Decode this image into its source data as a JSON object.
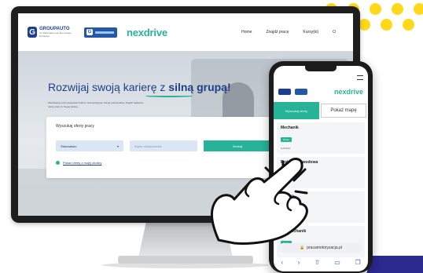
{
  "website": {
    "logo_groupauto": {
      "name": "GROUPAUTO",
      "sub": "Un Partenaire Lieu Du Groupe Européen"
    },
    "logo_box_initial": "G",
    "logo_nexdrive": "nexdrive",
    "menu": [
      "Home",
      "Znajdź pracę",
      "Kursy(ki)",
      "O"
    ],
    "hero": {
      "title_part1": "Rozwijaj swoją karierę z ",
      "title_part2": "silną grupą!",
      "description": "Zbudowane przez ekspertów branży motoryzacyjnej i dla jej pracowników. Znajdź najlepsze oferty pracy w Twojej okolicy."
    },
    "search": {
      "heading": "Wyszukaj oferty pracy",
      "select_value": "Stanowisko",
      "location_placeholder": "Wpisz miejscowość",
      "button": "Szukaj",
      "nearby_link": "Pokaż oferty z mojej okolicy"
    }
  },
  "phone": {
    "nexdrive": "nexdrive",
    "tab_active": "Wyszukaj oferty",
    "tab_map": "Pokaż mapę",
    "jobs": [
      {
        "title": "Mechanik",
        "badge": "Nowe",
        "company": "GANSZA",
        "address": "..."
      },
      {
        "title": "Praktyka zawodowa",
        "badge": "Nowe",
        "company": "",
        "address": ""
      },
      {
        "title": "...hanik",
        "badge": "",
        "company": "",
        "address": ""
      },
      {
        "title": "...romechanik",
        "badge": "Nowe",
        "company": "",
        "address": ""
      }
    ],
    "url": "pracamotoryzacja.pl"
  },
  "colors": {
    "brand_green": "#27b397",
    "brand_navy": "#1f3f8a",
    "accent_yellow": "#ffd81a"
  }
}
